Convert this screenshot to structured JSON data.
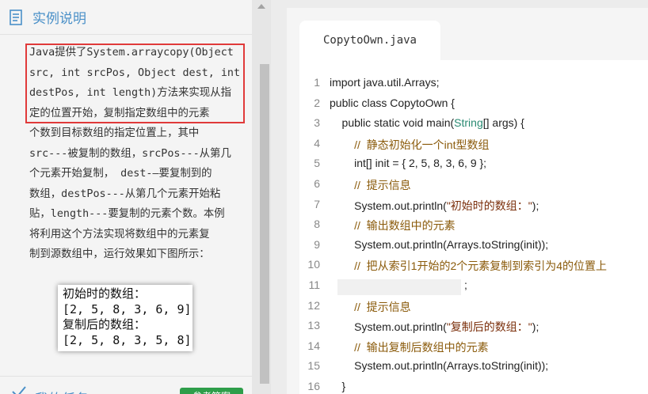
{
  "left_panel": {
    "title": "实例说明",
    "description_lines": [
      "Java提供了System.arraycopy(Object",
      "src, int srcPos, Object dest, int",
      "destPos, int length)方法来实现从指",
      "定的位置开始，复制指定数组中的元素",
      "个数到目标数组的指定位置上，其中",
      "src---被复制的数组，srcPos---从第几",
      "个元素开始复制， dest-—要复制到的",
      "数组，destPos---从第几个元素开始粘",
      "贴，length---要复制的元素个数。本例",
      "将利用这个方法实现将数组中的元素复",
      "制到源数组中，运行效果如下图所示："
    ],
    "result_lines": [
      "初始时的数组：",
      "[2, 5, 8, 3, 6, 9]",
      "复制后的数组：",
      "[2, 5, 8, 3, 5, 8]"
    ],
    "task_label": "我的任务",
    "answer_button": "参考答案"
  },
  "editor": {
    "tab_label": "CopytoOwn.java",
    "lines": [
      {
        "n": "1",
        "text": "import java.util.Arrays;"
      },
      {
        "n": "2",
        "text": "public class CopytoOwn {"
      },
      {
        "n": "3",
        "pre": "    public static void main(",
        "type": "String",
        "post": "[] args) {"
      },
      {
        "n": "4",
        "indent": "        ",
        "comment": "//  静态初始化一个int型数组"
      },
      {
        "n": "5",
        "text": "        int[] init = { 2, 5, 8, 3, 6, 9 };"
      },
      {
        "n": "6",
        "indent": "        ",
        "comment": "//  提示信息"
      },
      {
        "n": "7",
        "pre": "        System.out.println(",
        "string": "\"初始时的数组：\"",
        "post": ");"
      },
      {
        "n": "8",
        "indent": "        ",
        "comment": "//  输出数组中的元素"
      },
      {
        "n": "9",
        "text": "        System.out.println(Arrays.toString(init));"
      },
      {
        "n": "10",
        "indent": "        ",
        "comment": "//  把从索引1开始的2个元素复制到索引为4的位置上"
      },
      {
        "n": "11",
        "blank_input": "",
        "text": ";"
      },
      {
        "n": "12",
        "indent": "        ",
        "comment": "//  提示信息"
      },
      {
        "n": "13",
        "pre": "        System.out.println(",
        "string": "\"复制后的数组：\"",
        "post": ");"
      },
      {
        "n": "14",
        "indent": "        ",
        "comment": "//  输出复制后数组中的元素"
      },
      {
        "n": "15",
        "text": "        System.out.println(Arrays.toString(init));"
      },
      {
        "n": "16",
        "text": "    }"
      }
    ]
  },
  "colors": {
    "accent": "#4a90c8",
    "highlight_border": "#e03a3a",
    "comment": "#8a5a0a",
    "type": "#2a8a72",
    "string": "#7a2e0a",
    "answer_button": "#2e9e4a"
  },
  "icons": {
    "header": "document-list-icon",
    "task": "checkmark-task-icon"
  }
}
